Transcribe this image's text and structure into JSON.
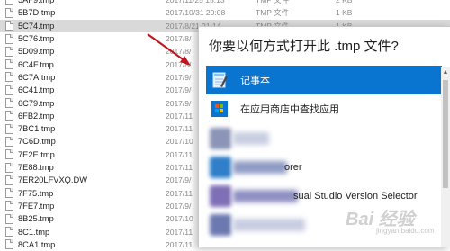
{
  "files": [
    {
      "name": "5AF9.tmp",
      "date": "2017/11/25 15:13",
      "type": "TMP 文件",
      "size": "2 KB"
    },
    {
      "name": "5B7D.tmp",
      "date": "2017/10/31 20:08",
      "type": "TMP 文件",
      "size": "1 KB"
    },
    {
      "name": "5C74.tmp",
      "date": "2017/8/21 21:14",
      "type": "TMP 文件",
      "size": "1 KB",
      "selected": true
    },
    {
      "name": "5C76.tmp",
      "date": "2017/8/",
      "type": "",
      "size": ""
    },
    {
      "name": "5D09.tmp",
      "date": "2017/8/",
      "type": "",
      "size": ""
    },
    {
      "name": "6C4F.tmp",
      "date": "2017/8/",
      "type": "",
      "size": ""
    },
    {
      "name": "6C7A.tmp",
      "date": "2017/9/",
      "type": "",
      "size": ""
    },
    {
      "name": "6C41.tmp",
      "date": "2017/9/",
      "type": "",
      "size": ""
    },
    {
      "name": "6C79.tmp",
      "date": "2017/9/",
      "type": "",
      "size": ""
    },
    {
      "name": "6FB2.tmp",
      "date": "2017/11",
      "type": "",
      "size": ""
    },
    {
      "name": "7BC1.tmp",
      "date": "2017/11",
      "type": "",
      "size": ""
    },
    {
      "name": "7C6D.tmp",
      "date": "2017/10",
      "type": "",
      "size": ""
    },
    {
      "name": "7E2E.tmp",
      "date": "2017/11",
      "type": "",
      "size": ""
    },
    {
      "name": "7E88.tmp",
      "date": "2017/11",
      "type": "",
      "size": ""
    },
    {
      "name": "7ER20LFVXQ.DW",
      "date": "2017/9/",
      "type": "",
      "size": ""
    },
    {
      "name": "7F75.tmp",
      "date": "2017/11",
      "type": "",
      "size": ""
    },
    {
      "name": "7FE7.tmp",
      "date": "2017/9/",
      "type": "",
      "size": ""
    },
    {
      "name": "8B25.tmp",
      "date": "2017/10",
      "type": "",
      "size": ""
    },
    {
      "name": "8C1.tmp",
      "date": "2017/11",
      "type": "",
      "size": ""
    },
    {
      "name": "8CA1.tmp",
      "date": "2017/11",
      "type": "",
      "size": ""
    }
  ],
  "dialog": {
    "title": "你要以何方式打开此 .tmp 文件?",
    "options": [
      {
        "label": "记事本",
        "icon": "notepad-icon",
        "highlighted": true
      },
      {
        "label": "在应用商店中查找应用",
        "icon": "store-icon",
        "highlighted": false
      }
    ],
    "blurred_options": [
      {
        "visible_text": ""
      },
      {
        "visible_text": "orer"
      },
      {
        "visible_text": "sual Studio Version Selector"
      },
      {
        "visible_text": ""
      }
    ]
  },
  "watermark": {
    "text": "Bai 经验",
    "sub": "jingyan.baidu.com"
  },
  "colors": {
    "highlight": "#0a74d1",
    "arrow": "#c0141c",
    "selected_row": "#d9d9d9"
  }
}
